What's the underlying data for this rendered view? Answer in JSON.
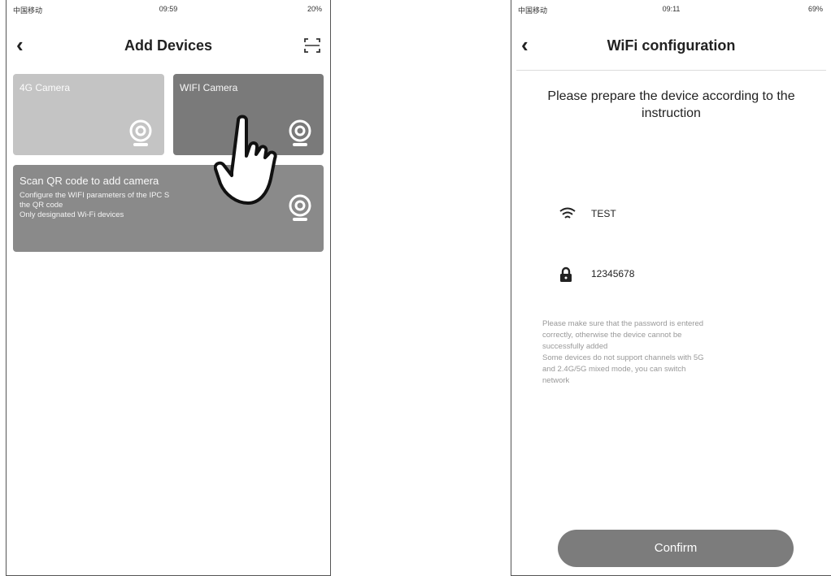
{
  "left_screen": {
    "status": {
      "carrier": "中国移动",
      "time": "09:59",
      "battery": "20%"
    },
    "header": {
      "title": "Add Devices",
      "back_icon": "chevron-left-icon",
      "scan_icon": "scan-icon"
    },
    "cards": {
      "4g_camera": {
        "label": "4G Camera"
      },
      "wifi_camera": {
        "label": "WIFI Camera"
      },
      "scan_qr": {
        "title": "Scan QR code to add camera",
        "line1": "Configure the WIFI parameters of the IPC S",
        "line2": "the QR code",
        "line3": "Only designated Wi-Fi devices"
      }
    }
  },
  "right_screen": {
    "status": {
      "carrier": "中国移动",
      "time": "09:11",
      "battery": "69%"
    },
    "header": {
      "title": "WiFi configuration",
      "back_icon": "chevron-left-icon"
    },
    "prompt": {
      "line1": "Please prepare the device according to the",
      "line2": "instruction"
    },
    "wifi": {
      "ssid": "TEST",
      "icon": "wifi-icon"
    },
    "password": {
      "value": "12345678",
      "icon": "lock-icon"
    },
    "note": {
      "line1": "Please make sure that the password is entered",
      "line2": "correctly, otherwise the device cannot be",
      "line3": "successfully added",
      "line4": "Some devices do not support channels with 5G",
      "line5": "and 2.4G/5G mixed mode, you can switch",
      "line6": "network"
    },
    "confirm_label": "Confirm"
  },
  "colors": {
    "card_light": "#c4c4c4",
    "card_dark": "#7a7a7a",
    "card_scan": "#8a8a8a",
    "button": "#7c7c7c"
  }
}
